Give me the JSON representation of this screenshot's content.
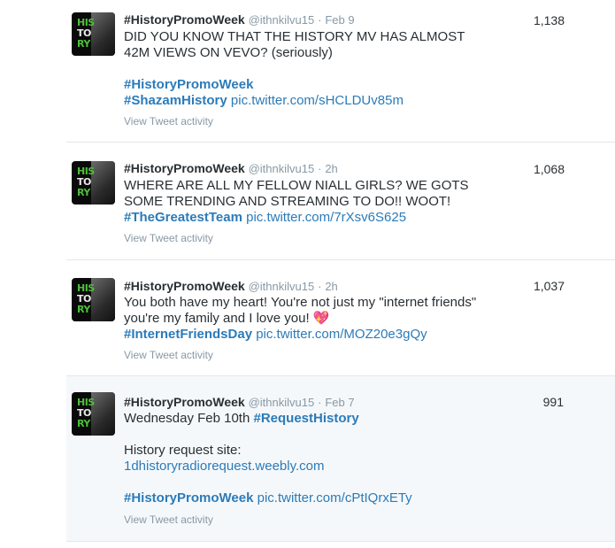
{
  "tweets": [
    {
      "name": "#HistoryPromoWeek",
      "handle": "@ithnkilvu15",
      "dot": "·",
      "time": "Feb 9",
      "count": "1,138",
      "text1": "DID YOU KNOW THAT THE HISTORY MV HAS ALMOST",
      "text2": "42M VIEWS ON VEVO? (seriously)",
      "hashtag1": "#HistoryPromoWeek",
      "hashtag2": "#ShazamHistory",
      "link": "pic.twitter.com/sHCLDUv85m",
      "activity": "View Tweet activity"
    },
    {
      "name": "#HistoryPromoWeek",
      "handle": "@ithnkilvu15",
      "dot": "·",
      "time": "2h",
      "count": "1,068",
      "text1": "WHERE ARE ALL MY FELLOW NIALL GIRLS? WE GOTS",
      "text2": "SOME TRENDING AND STREAMING TO DO!!  WOOT!",
      "hashtag1": "#TheGreatestTeam",
      "link": "pic.twitter.com/7rXsv6S625",
      "activity": "View Tweet activity"
    },
    {
      "name": "#HistoryPromoWeek",
      "handle": "@ithnkilvu15",
      "dot": "·",
      "time": "2h",
      "count": "1,037",
      "text1": "You both have my heart! You're not just my \"internet friends\"",
      "text2": "you're my family and I love you! 💖",
      "hashtag1": "#InternetFriendsDay",
      "link": "pic.twitter.com/MOZ20e3gQy",
      "activity": "View Tweet activity"
    },
    {
      "name": "#HistoryPromoWeek",
      "handle": "@ithnkilvu15",
      "dot": "·",
      "time": "Feb 7",
      "count": "991",
      "text1": "Wednesday Feb 10th ",
      "hashtag_inline": "#RequestHistory",
      "text2": "History request site:",
      "site": "1dhistoryradiorequest.weebly.com",
      "hashtag1": "#HistoryPromoWeek",
      "link": "pic.twitter.com/cPtIQrxETy",
      "activity": "View Tweet activity"
    }
  ],
  "avatar": {
    "l1": "HIS",
    "l2": "TO",
    "l3": "RY"
  }
}
